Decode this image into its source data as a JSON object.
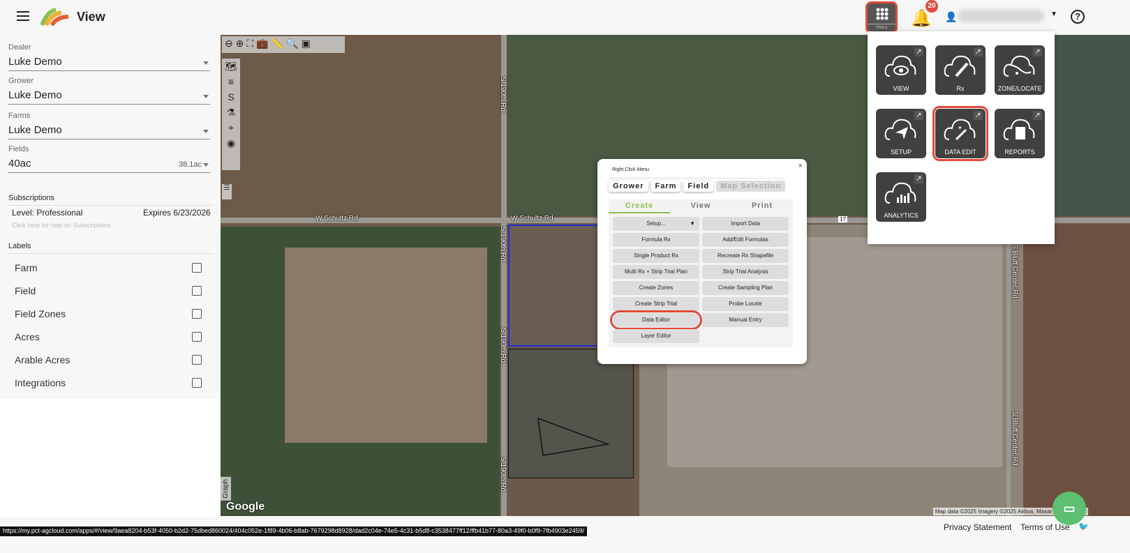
{
  "header": {
    "title": "View",
    "notifications": "20",
    "tools_label": "TOOLS",
    "help": "?"
  },
  "sidebar": {
    "dealer": {
      "label": "Dealer",
      "value": "Luke Demo"
    },
    "grower": {
      "label": "Grower",
      "value": "Luke Demo"
    },
    "farms": {
      "label": "Farms",
      "value": "Luke Demo"
    },
    "fields": {
      "label": "Fields",
      "value": "40ac",
      "acres": "38.1ac"
    },
    "subscriptions": {
      "title": "Subscriptions",
      "level": "Level: Professional",
      "expires": "Expires 6/23/2026",
      "help": "Click here for help on Subscriptions"
    },
    "labels": {
      "title": "Labels",
      "items": [
        "Farm",
        "Field",
        "Field Zones",
        "Acres",
        "Arable Acres",
        "Integrations"
      ]
    }
  },
  "map": {
    "roads": [
      "W Schultz Rd",
      "W Schultz Rd",
      "S 190th Rd",
      "S 190th Rd",
      "S 190th Rd",
      "S 190th Rd",
      "S Bluff Center Rd",
      "S Bluff Center Rd",
      "17"
    ],
    "google": "Google",
    "attribution": "Map data ©2025 Imagery ©2025 Airbus, Maxar Technologies",
    "graph": "Graph"
  },
  "right_click_menu": {
    "title": "Right Click Menu",
    "close": "×",
    "scope_tabs": [
      "Grower",
      "Farm",
      "Field",
      "Map Selection"
    ],
    "tabs": [
      "Create",
      "View",
      "Print"
    ],
    "buttons": [
      "Setup...",
      "Import Data",
      "Formula Rx",
      "Add/Edit Formulas",
      "Single Product Rx",
      "Recreate Rx Shapefile",
      "Multi Rx + Strip Trial Plan",
      "Strip Trial Analysis",
      "Create Zones",
      "Create Sampling Plan",
      "Create Strip Trial",
      "Probe Locate",
      "Data Editor",
      "Manual Entry",
      "Layer Editor"
    ]
  },
  "tools_panel": {
    "tiles": [
      "VIEW",
      "Rx",
      "ZONE/LOCATE",
      "SETUP",
      "DATA EDIT",
      "REPORTS",
      "ANALYTICS"
    ]
  },
  "footer": {
    "url": "https://my.pct-agcloud.com/apps/#/view/9aea8204-b53f-4050-b2d2-75dbed860024/404c052e-1f89-4b06-b8ab-7679298d8928/dad2c04e-74e5-4c31-b5d8-c3538477ff12/ffb41b77-80a3-49f0-b0f9-7fb4903e2459/",
    "privacy": "Privacy Statement",
    "terms": "Terms of Use"
  },
  "colors": {
    "accent": "#8cc152",
    "highlight": "#e04a3a",
    "tile": "#404040"
  }
}
